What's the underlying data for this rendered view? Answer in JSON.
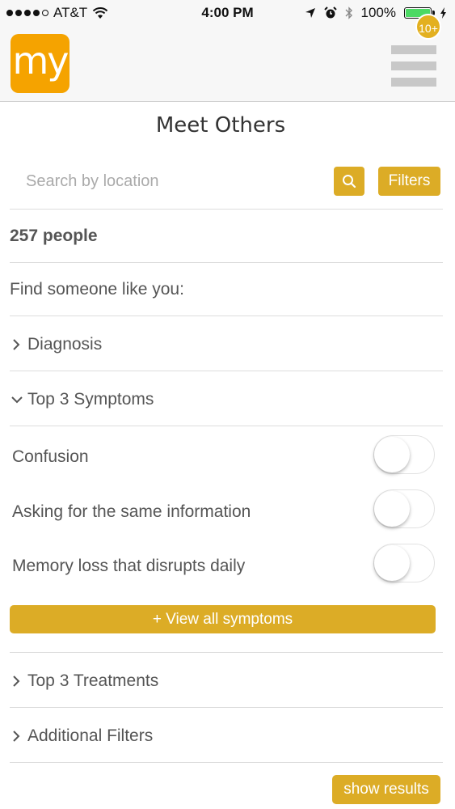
{
  "status_bar": {
    "carrier": "AT&T",
    "time": "4:00 PM",
    "battery_percent": "100%",
    "battery_level": 1.0,
    "icons": [
      "signal-dots",
      "wifi-icon",
      "location-arrow-icon",
      "alarm-icon",
      "bluetooth-icon",
      "battery-icon",
      "charging-bolt-icon"
    ]
  },
  "header": {
    "logo_text": "my",
    "notification_badge": "10+",
    "logo_color": "#f5a300",
    "menu_icon": "hamburger-menu-icon"
  },
  "page": {
    "title": "Meet Others"
  },
  "search": {
    "placeholder": "Search by location",
    "value": "",
    "filters_label": "Filters"
  },
  "results": {
    "count_label": "257 people",
    "prompt": "Find someone like you:"
  },
  "sections": {
    "diagnosis": "Diagnosis",
    "top_symptoms": "Top 3 Symptoms",
    "top_treatments": "Top 3 Treatments",
    "additional_filters": "Additional Filters"
  },
  "symptoms": [
    {
      "label": "Confusion",
      "enabled": false
    },
    {
      "label": "Asking for the same information",
      "enabled": false
    },
    {
      "label": "Memory loss that disrupts daily",
      "enabled": false
    }
  ],
  "buttons": {
    "view_all_symptoms": "+ View all symptoms",
    "show_results": "show results"
  },
  "colors": {
    "accent": "#dcac26",
    "text": "#555555",
    "divider": "#dddddd"
  }
}
